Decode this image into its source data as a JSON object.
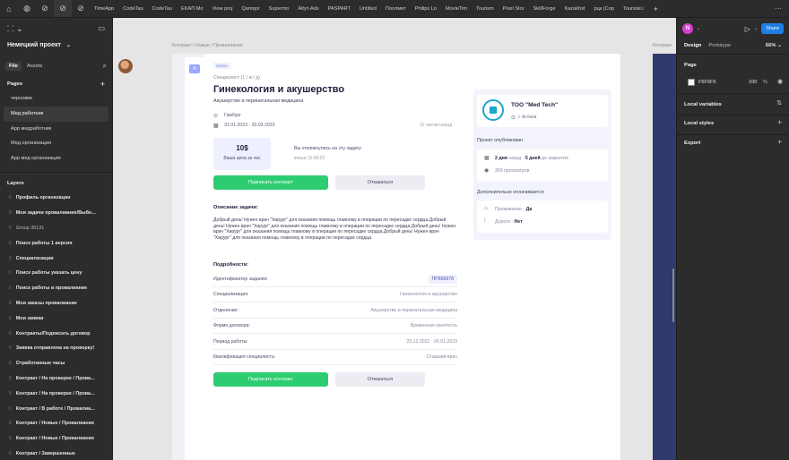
{
  "tabs": [
    "TimeApp",
    "CodeTau",
    "CodeTau",
    "EKAП Mo",
    "View proj",
    "Qamqor",
    "Supermo",
    "Altyn Ads",
    "PASPART",
    "Untitled",
    "Поллмет",
    "Philips Lo",
    "MovieTim",
    "Tourism",
    "Pixel Stor",
    "SkillForge",
    "Kazakhst",
    "рцк (Cop",
    "Tourstat.i"
  ],
  "left": {
    "project": "Немецкий проект",
    "file_tab": "File",
    "assets_tab": "Assets",
    "pages_label": "Pages",
    "pages": [
      "черновик",
      "Мед работник",
      "App медработник",
      "Мед организация",
      "App мед организация"
    ],
    "selected_page": 1,
    "layers_label": "Layers",
    "layers": [
      {
        "label": "Профиль организации",
        "bold": true
      },
      {
        "label": "Мои задачи провалиание/Выбо...",
        "bold": true
      },
      {
        "label": "Group 35131",
        "bold": false
      },
      {
        "label": "Поиск работы 1 версия",
        "bold": true
      },
      {
        "label": "Специализация",
        "bold": true
      },
      {
        "label": "Поиск работы указать цену",
        "bold": true
      },
      {
        "label": "Поиск работы в провалиание",
        "bold": true
      },
      {
        "label": "Мои заказы провалиание",
        "bold": true
      },
      {
        "label": "Мои заявки",
        "bold": true
      },
      {
        "label": "Контракты/Подписать договор",
        "bold": true
      },
      {
        "label": "Заявка отправлена на проверку!",
        "bold": true
      },
      {
        "label": "Отработанные часы",
        "bold": true
      },
      {
        "label": "Контракт / На проверке / Прова...",
        "bold": true
      },
      {
        "label": "Контракт / На проверке / Прова...",
        "bold": true
      },
      {
        "label": "Контракт / В работе / Провалиа...",
        "bold": true
      },
      {
        "label": "Контракт / Новые / Провалиание",
        "bold": true
      },
      {
        "label": "Контракт / Новые / Провалиание",
        "bold": true
      },
      {
        "label": "Контракт / Завершенные",
        "bold": true
      }
    ]
  },
  "canvas": {
    "frame_label": "Контракт / Новые / Провалиание",
    "frame_label2": "Контракт",
    "badge": "Новое",
    "specialist": "Специалист  (1 / ж / д)",
    "title": "Гинекология и акушерство",
    "subtitle": "Акушерство и перинатальная медицина",
    "city": "Гамбург",
    "dates": "31.01.2023 - 30.03.2023",
    "ago": "11 часов назад",
    "price": "10$",
    "price_caption": "Ваша цена за час",
    "response": "Вы откликнулись на эту задачу",
    "response_time": "вчера 15:00:02",
    "sign_button": "Подписать контракт",
    "decline_button": "Отказаться",
    "desc_header": "Описание задачи:",
    "description": "Добрый день! Нужен врач \"Хирург\" для оказания помощь главному в операции по пересадке сердца.Добрый день! Нужен врач \"Хирург\" для оказания помощь главному в операции по пересадке сердца.Добрый день! Нужен врач \"Хирург\" для оказания помощь главному в операции по пересадке сердца.Добрый день! Нужен врач \"Хирург\" для оказания помощь главному в операции по пересадке сердца.",
    "details_header": "Подробности:",
    "details": [
      {
        "k": "Идентификатор задания:",
        "v": "ПР856978",
        "pill": true
      },
      {
        "k": "Специализация:",
        "v": "Гинекология и акушерство",
        "pill": false
      },
      {
        "k": "Отделение:",
        "v": "Акушерство и перинатальная медицина",
        "pill": false
      },
      {
        "k": "Форма договора:",
        "v": "Временная занятость",
        "pill": false
      },
      {
        "k": "Период работы:",
        "v": "23.12.2022 - 06.01.2023",
        "pill": false
      },
      {
        "k": "Квалификация специалиста",
        "v": "Старший врач",
        "pill": false
      }
    ],
    "company": "ТОО \"Med Tech\"",
    "company_city": "г. Астана",
    "published": "Проект опубликован",
    "days_ago": "2 дня",
    "days_ago_suffix": "назад",
    "days_left": "5 дней",
    "days_left_suffix": "до закрытия",
    "views": "369 просмотров",
    "extra_paid": "Дополнительно оплачивается",
    "housing": "Проживание",
    "housing_val": "Да",
    "road": "Дорога",
    "road_val": "Нет"
  },
  "right": {
    "avatar_letter": "N",
    "share": "Share",
    "design_tab": "Design",
    "prototype_tab": "Prototype",
    "zoom": "66%",
    "page_label": "Page",
    "fill_hex": "F5F5F5",
    "fill_opacity": "100",
    "fill_unit": "%",
    "local_variables": "Local variables",
    "local_styles": "Local styles",
    "export": "Export"
  },
  "colors": {
    "accent": "#1e7fe6",
    "green": "#2ecc71",
    "avatar": "#d63fd6"
  }
}
